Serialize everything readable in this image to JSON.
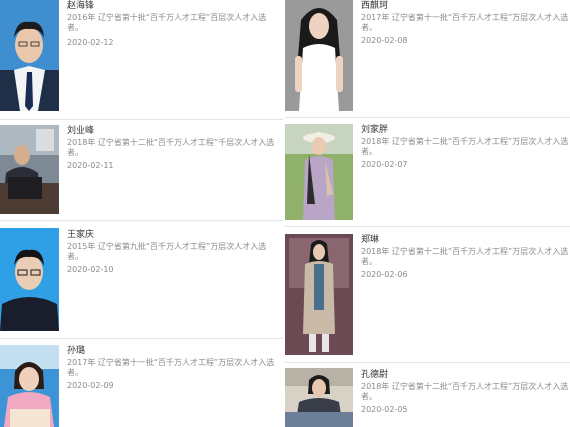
{
  "profiles": [
    {
      "name": "赵海锋",
      "desc": "2016年 辽宁省第十批“百千万人才工程”百层次人才入选者。",
      "date": "2020-02-12",
      "photo": "portrait-man-suit"
    },
    {
      "name": "西麒珂",
      "desc": "2017年 辽宁省第十一批“百千万人才工程”万层次人才入选者。",
      "date": "2020-02-08",
      "photo": "portrait-woman-white-dress"
    },
    {
      "name": "刘业峰",
      "desc": "2018年 辽宁省第十二批“百千万人才工程”千层次人才入选者。",
      "date": "2020-02-11",
      "photo": "portrait-man-desk"
    },
    {
      "name": "刘家胖",
      "desc": "2018年 辽宁省第十二批“百千万人才工程”万层次人才入选者。",
      "date": "2020-02-07",
      "photo": "portrait-woman-hat"
    },
    {
      "name": "王家庆",
      "desc": "2015年 辽宁省第九批“百千万人才工程”万层次人才入选者。",
      "date": "2020-02-10",
      "photo": "portrait-man-glasses"
    },
    {
      "name": "郑琳",
      "desc": "2018年 辽宁省第十二批“百千万人才工程”万层次人才入选者。",
      "date": "2020-02-06",
      "photo": "portrait-woman-coat"
    },
    {
      "name": "孙璐",
      "desc": "2017年 辽宁省第十一批“百千万人才工程”万层次人才入选者。",
      "date": "2020-02-09",
      "photo": "portrait-woman-pink"
    },
    {
      "name": "孔德尉",
      "desc": "2018年 辽宁省第十二批“百千万人才工程”万层次人才入选者。",
      "date": "2020-02-05",
      "photo": "portrait-woman-couch"
    }
  ]
}
